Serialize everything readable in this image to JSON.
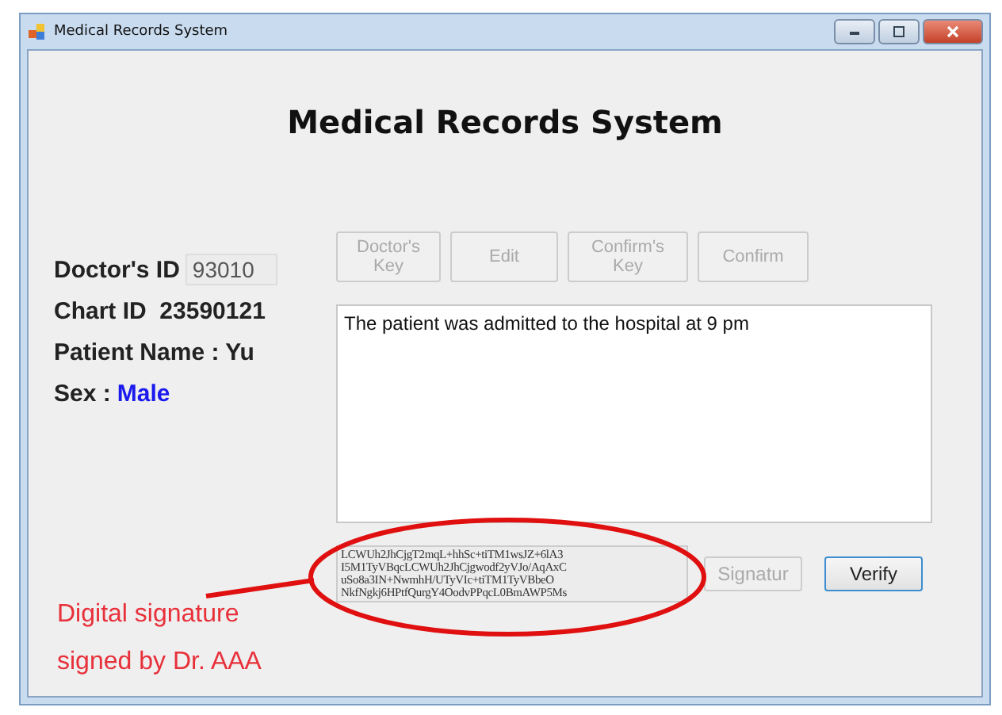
{
  "window": {
    "title": "Medical Records System"
  },
  "heading": "Medical Records System",
  "doctor_id": {
    "label": "Doctor's ID",
    "value": "93010"
  },
  "chart_id": {
    "label": "Chart ID",
    "value": "23590121"
  },
  "patient_name": {
    "label": "Patient Name :",
    "value": "Yu"
  },
  "sex": {
    "label": "Sex :",
    "value": "Male"
  },
  "buttons": [
    {
      "label": "Doctor's Key",
      "disabled": true
    },
    {
      "label": "Edit",
      "disabled": true
    },
    {
      "label": "Confirm's Key",
      "disabled": true
    },
    {
      "label": "Confirm",
      "disabled": true
    }
  ],
  "record_text": "The patient was admitted to the hospital at 9 pm",
  "signature_lines": [
    "LCWUh2JhCjgT2mqL+hhSc+tiTM1wsJZ+6lA3",
    "I5M1TyVBqcLCWUh2JhCjgwodf2yVJo/AqAxC",
    "uSo8a3IN+NwmhH/UTyVIc+tiTM1TyVBbeO",
    "NkfNgkj6HPtfQurgY4OodvPPqcL0BmAWP5Ms"
  ],
  "signature_button": {
    "label": "Signatur",
    "disabled": true
  },
  "verify_button": {
    "label": "Verify",
    "disabled": false
  },
  "annotation": [
    "Digital signature",
    "signed by Dr. AAA"
  ]
}
